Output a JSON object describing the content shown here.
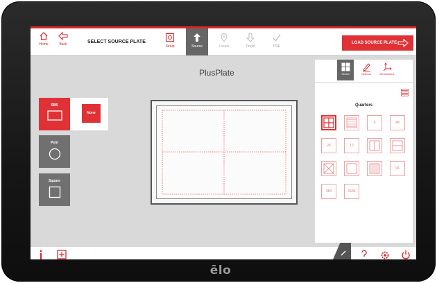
{
  "brand": "ēlo",
  "topbar": {
    "home_label": "Home",
    "back_label": "Back",
    "title": "SELECT SOURCE PLATE",
    "steps": [
      {
        "label": "Setup"
      },
      {
        "label": "Source"
      },
      {
        "label": "Locate"
      },
      {
        "label": "Target"
      },
      {
        "label": "PRE"
      }
    ],
    "load_button": "LOAD SOURCE PLATE"
  },
  "main": {
    "title": "PlusPlate",
    "plate_types": [
      {
        "label": "SBS"
      },
      {
        "label": "Petri"
      },
      {
        "label": "Square"
      }
    ],
    "none_label": "None"
  },
  "right_panel": {
    "tabs": [
      {
        "label": "Sector"
      },
      {
        "label": "Options"
      },
      {
        "label": "Dimensions"
      }
    ],
    "section_title": "Quarters",
    "formats": [
      {
        "label": ""
      },
      {
        "label": ""
      },
      {
        "label": "6"
      },
      {
        "label": "48"
      },
      {
        "label": "24"
      },
      {
        "label": "12"
      },
      {
        "label": ""
      },
      {
        "label": ""
      },
      {
        "label": ""
      },
      {
        "label": ""
      },
      {
        "label": ""
      },
      {
        "label": "96"
      },
      {
        "label": "384"
      },
      {
        "label": "1536"
      }
    ]
  },
  "colors": {
    "accent": "#e03236",
    "active_tab": "#666666",
    "screen_bg": "#d9d9d9"
  }
}
